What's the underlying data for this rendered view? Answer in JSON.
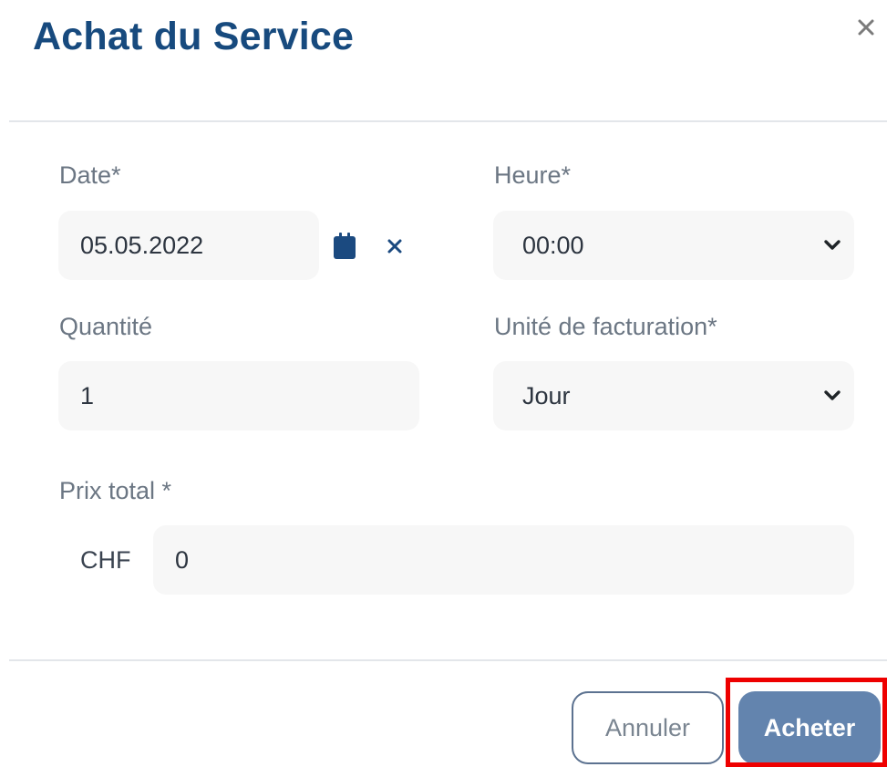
{
  "dialog": {
    "title": "Achat du Service",
    "close_icon": "close-icon"
  },
  "form": {
    "date": {
      "label": "Date*",
      "value": "05.05.2022",
      "calendar_icon": "calendar-icon",
      "clear_icon": "clear-x-icon"
    },
    "time": {
      "label": "Heure*",
      "value": "00:00",
      "chevron_icon": "chevron-down-icon"
    },
    "quantity": {
      "label": "Quantité",
      "value": "1"
    },
    "billing_unit": {
      "label": "Unité de facturation*",
      "value": "Jour",
      "chevron_icon": "chevron-down-icon"
    },
    "total_price": {
      "label": "Prix total *",
      "currency": "CHF",
      "value": "0"
    }
  },
  "footer": {
    "cancel_label": "Annuler",
    "buy_label": "Acheter"
  },
  "colors": {
    "title": "#174a7e",
    "primary_button": "#6384ae",
    "highlight_box": "#ee0000",
    "icon": "#1b4a80"
  }
}
